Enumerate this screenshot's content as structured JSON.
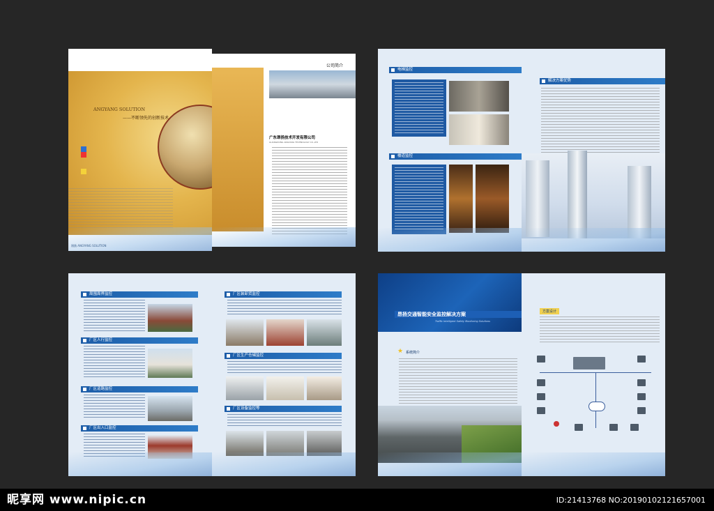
{
  "spread1": {
    "left": {
      "brand_en": "ANGYANG SOLUTION",
      "slogan": "——不断领先的创新技术",
      "footer_left": "昂扬 ANGYANG SOLUTION"
    },
    "right": {
      "section_title": "公司简介",
      "company_name": "广东昂扬技术开发有限公司",
      "company_name_en": "GUANGDONG ANGYANG TECHNOLOGY CO.,LTD"
    }
  },
  "spread2": {
    "elevator_title": "电梯监控",
    "corridor_title": "楼道监控",
    "solution_title": "解决方案优势"
  },
  "spread3": {
    "left_titles": [
      "周围周界监控",
      "厂区人行监控",
      "厂区道路监控",
      "厂区出入口监控"
    ],
    "right_titles": [
      "厂区装卸货监控",
      "厂区生产仓储监控",
      "厂区设备监控等"
    ]
  },
  "spread4": {
    "banner_title": "昂扬交通智能安全监控解决方案",
    "banner_subtitle": "Traffic Intelligent Safety Monitoring Solutions",
    "system_title": "系统简介",
    "design_title": "方案设计"
  },
  "watermark": {
    "logo": "昵享网 www.nipic.cn",
    "id": "ID:21413768 NO:20190102121657001"
  }
}
